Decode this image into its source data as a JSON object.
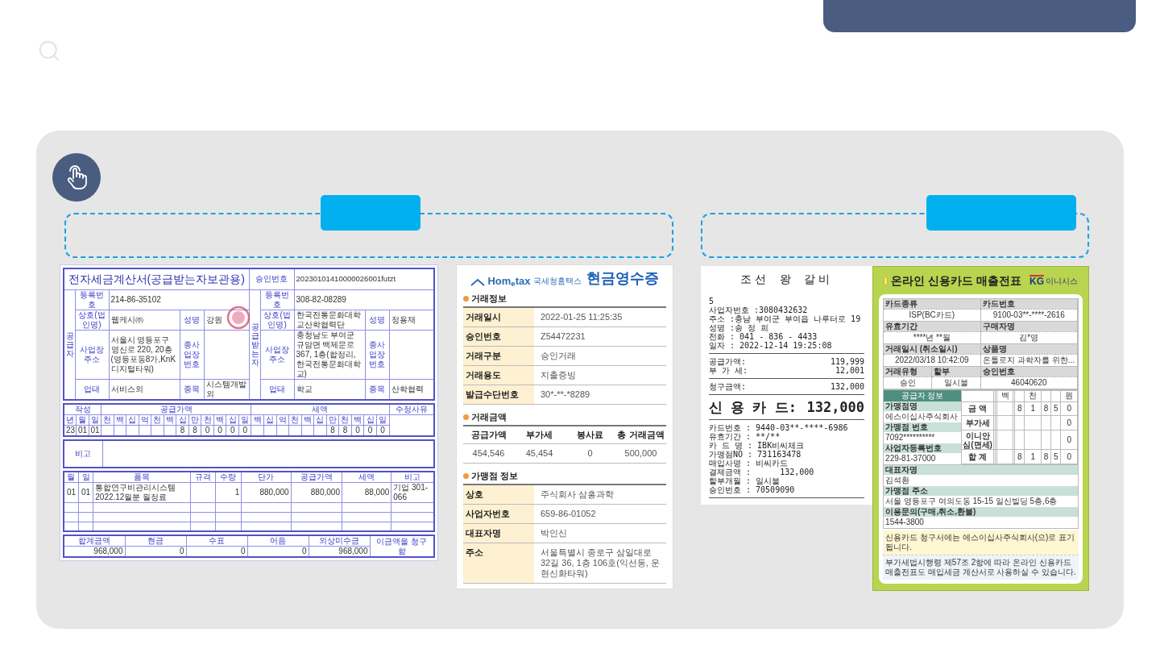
{
  "invoice": {
    "title": "전자세금계산서(공급받는자보관용)",
    "approval_label": "승인번호",
    "approval_number": "20230101410000026001futzt",
    "supplier": {
      "side_label": "공급자",
      "reg_label": "등록번호",
      "reg_number": "214-86-35102",
      "name_label": "상호(법인명)",
      "name": "웹케시㈜",
      "rep_label": "성명",
      "rep": "강원",
      "address_label": "사업장 주소",
      "address": "서울시 영등포구 영신로 220, 20층(영등포동8가,KnK디지털타워)",
      "branch_label": "종사업장번호",
      "type_label": "업태",
      "type": "서비스외",
      "item_label": "종목",
      "item": "시스템개발외"
    },
    "recipient": {
      "side_label": "공급받는자",
      "reg_label": "등록번호",
      "reg_number": "308-82-08289",
      "name_label": "상호(법인명)",
      "name": "한국전통문화대학교산학협력단",
      "rep_label": "성명",
      "rep": "정용재",
      "address_label": "사업장 주소",
      "address": "충청남도 부여군 규암면 백제문로 367, 1층(합정리, 한국전통문화대학교)",
      "branch_label": "종사업장번호",
      "type_label": "업태",
      "type": "학교",
      "item_label": "종목",
      "item": "산학협력"
    },
    "date_label": "작성",
    "supply_label": "공급가액",
    "tax_label": "세액",
    "reason_label": "수정사유",
    "date_units": [
      "년",
      "월",
      "일"
    ],
    "supply_units": [
      "천",
      "백",
      "십",
      "억",
      "천",
      "백",
      "십",
      "만",
      "천",
      "백",
      "십",
      "일"
    ],
    "tax_units": [
      "백",
      "십",
      "억",
      "천",
      "백",
      "십",
      "만",
      "천",
      "백",
      "십",
      "일"
    ],
    "date": [
      "23",
      "01",
      "01"
    ],
    "supply_digits": [
      "8",
      "8",
      "0",
      "0",
      "0",
      "0"
    ],
    "tax_digits": [
      "8",
      "8",
      "0",
      "0",
      "0"
    ],
    "remarks_label": "비고",
    "item_columns": [
      "월",
      "일",
      "품목",
      "규격",
      "수량",
      "단가",
      "공급가액",
      "세액",
      "비고"
    ],
    "items": [
      {
        "month": "01",
        "day": "01",
        "name": "통합연구비관리시스템 2022.12월분 월정료",
        "qty": "1",
        "unit_price": "880,000",
        "supply": "880,000",
        "tax": "88,000",
        "note": "기업 301-066"
      }
    ],
    "total_columns": [
      "합계금액",
      "현금",
      "수표",
      "어음",
      "외상미수금"
    ],
    "total_values": [
      "968,000",
      "0",
      "0",
      "0",
      "968,000"
    ],
    "claim": "이금액을 청구 함"
  },
  "cash_receipt": {
    "logo": "Hom$_{e}$tax",
    "logo_sub": "국세청홈택스",
    "title": "현금영수증",
    "sections": [
      {
        "kind": "fields",
        "heading": "거래정보",
        "rows": [
          {
            "label": "거래일시",
            "value": "2022-01-25 11:25:35"
          },
          {
            "label": "승인번호",
            "value": "Z54472231"
          },
          {
            "label": "거래구분",
            "value": "승인거래"
          },
          {
            "label": "거래용도",
            "value": "지출증빙"
          },
          {
            "label": "발급수단번호",
            "value": "30*-**-*8289"
          }
        ]
      },
      {
        "kind": "amounts",
        "heading": "거래금액",
        "columns": [
          "공급가액",
          "부가세",
          "봉사료",
          "총 거래금액"
        ],
        "values": [
          "454,546",
          "45,454",
          "0",
          "500,000"
        ]
      },
      {
        "kind": "fields",
        "heading": "가맹점 정보",
        "rows": [
          {
            "label": "상호",
            "value": "주식회사 삼홍과학"
          },
          {
            "label": "사업자번호",
            "value": "659-86-01052"
          },
          {
            "label": "대표자명",
            "value": "박인신"
          },
          {
            "label": "주소",
            "value": "서울특별시 종로구 삼일대로32길 36, 1층 106호(익선동, 운현신화타워)"
          }
        ]
      }
    ]
  },
  "card_slip": {
    "title": "조선 왕 갈비",
    "header_lines": [
      "5",
      "사업자번호 :3080432632",
      "주소 :충남 부여군 부여읍 나루터로 19",
      "성명 :송 정 희",
      "전화 : 041 - 836 - 4433",
      "일자 : 2022-12-14 19:25:08"
    ],
    "amount_rows": [
      {
        "label": "공급가액:",
        "value": "119,999"
      },
      {
        "label": "부 가 세:",
        "value": "12,001"
      }
    ],
    "billed": {
      "label": "청구금액:",
      "value": "132,000"
    },
    "payment": {
      "label": "신 용 카 드:",
      "value": "132,000"
    },
    "card_lines": [
      "카드번호 : 9440-03**-****-6986",
      "유효기간 : **/**",
      "카 드 명 : IBK비씨체크",
      "가맹점NO : 731163478",
      "매입사명 : 비씨카드",
      "결제금액 :      132,000",
      "할부개월 : 일시불",
      "승인번호 : 70509090"
    ]
  },
  "online_slip": {
    "title": "온라인 신용카드 매출전표",
    "brand": "KG",
    "brand_sub": "이니시스",
    "fields": [
      {
        "label": "카드종류",
        "value": "ISP(BC카드)"
      },
      {
        "label": "카드번호",
        "value": "9100-03**-****-2616"
      },
      {
        "label": "유효기간",
        "value": "****년 **월"
      },
      {
        "label": "구매자명",
        "value": "김*영"
      },
      {
        "label": "거래일시 (취소일시)",
        "value": "2022/03/18 10:42:09"
      },
      {
        "label": "상품명",
        "value": "온톨로지 과학자를 위한..."
      },
      {
        "label": "거래유형",
        "value": "승인"
      },
      {
        "label": "할부",
        "value": "일시불"
      },
      {
        "label": "승인번호",
        "value": "46040620"
      }
    ],
    "supplier_heading": "공급자 정보",
    "supplier_rows": [
      {
        "label": "가맹점명",
        "value": "에스이십사주식회사"
      },
      {
        "label": "가맹점 번호",
        "value": "7092**********"
      },
      {
        "label": "사업자등록번호",
        "value": "229-81-37000"
      }
    ],
    "unit_header": "  백  천  원",
    "amount_rows": [
      {
        "label": "금 액",
        "digits": [
          "8",
          "1",
          "8",
          "5",
          "0"
        ]
      },
      {
        "label": "부가세",
        "digits": [
          "0"
        ]
      },
      {
        "label": "이니안심(면세)",
        "digits": [
          "0"
        ]
      },
      {
        "label": "합 계",
        "digits": [
          "8",
          "1",
          "8",
          "5",
          "0"
        ]
      }
    ],
    "info_rows": [
      {
        "label": "대표자명",
        "value": "김석환"
      },
      {
        "label": "가맹점 주소",
        "value": "서울 영등포구 여의도동 15-15 일신빌딩 5층,6층"
      },
      {
        "label": "이용문의(구매,취소,환불)",
        "value": "1544-3800"
      }
    ],
    "notice": "신용카드 청구서에는 에스이십사주식회사(으)로 표기됩니다.",
    "footnote": "부가세법시행령 제57조 2항에 따라 온라인 신용카드 매출전표도 매입세금 계산서로 사용하실 수 있습니다."
  }
}
